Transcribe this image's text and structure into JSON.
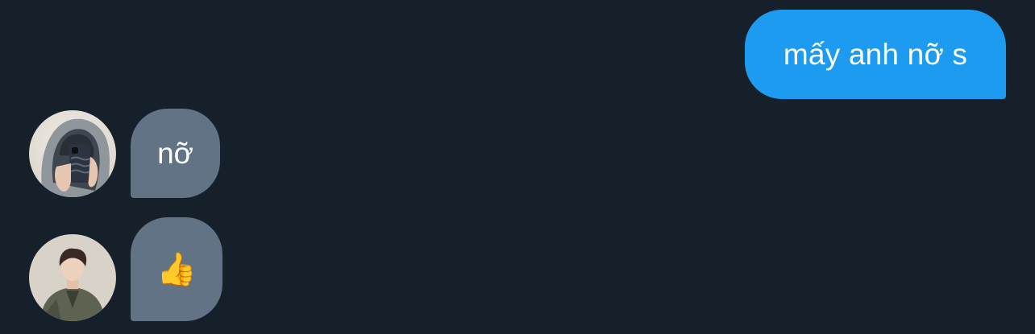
{
  "conversation": {
    "messages": [
      {
        "direction": "outgoing",
        "text": "mấy anh nỡ s"
      },
      {
        "direction": "incoming",
        "sender_avatar": "avatar-hooded-mirror-selfie",
        "text": "nỡ"
      },
      {
        "direction": "incoming",
        "sender_avatar": "avatar-young-man-jacket",
        "emoji": "👍",
        "emoji_name": "thumbs-up-icon"
      }
    ]
  },
  "colors": {
    "background": "#16202b",
    "outgoing_bubble": "#1d9bf0",
    "incoming_bubble": "#627386",
    "text": "#ffffff"
  }
}
